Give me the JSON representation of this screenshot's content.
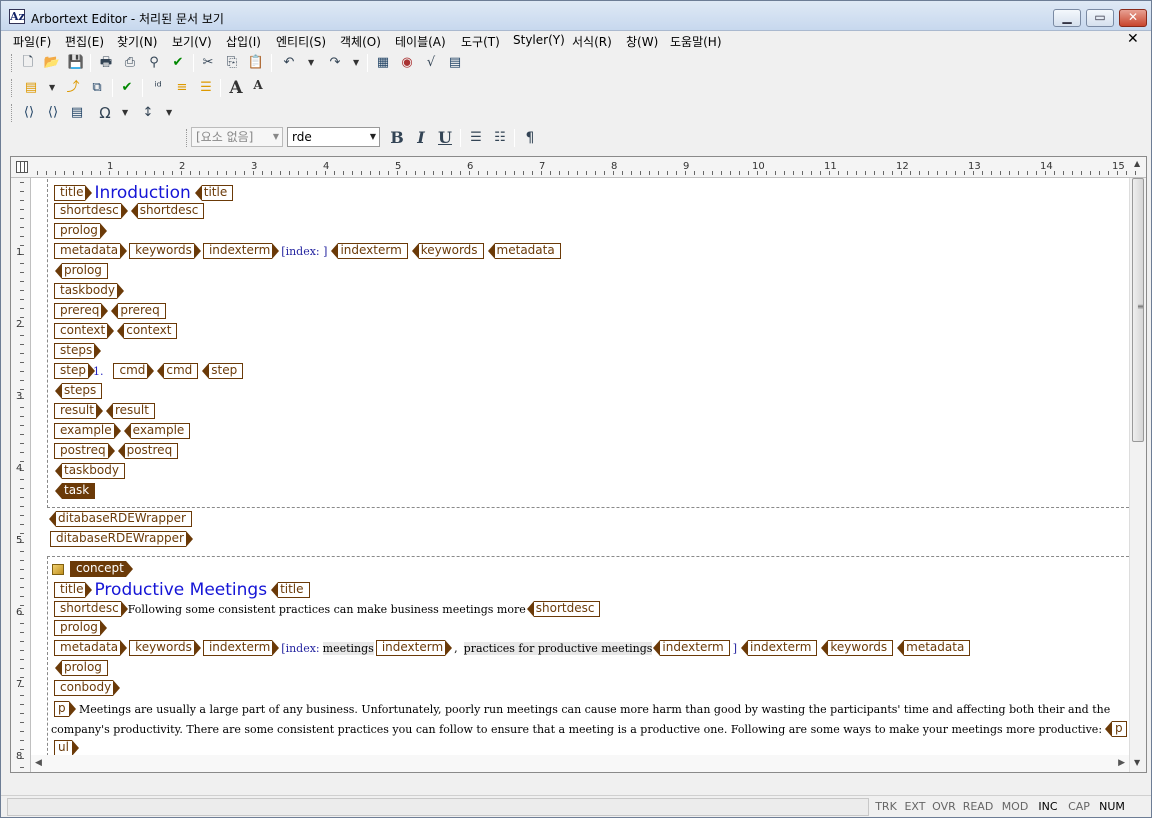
{
  "window": {
    "app_name": "Arbortext Editor",
    "title_sep": " - ",
    "doc_title": "처리된 문서 보기",
    "app_icon": "Az"
  },
  "menu": [
    "파일(F)",
    "편집(E)",
    "찾기(N)",
    "보기(V)",
    "삽입(I)",
    "엔티티(S)",
    "객체(O)",
    "테이블(A)",
    "도구(T)",
    "Styler(Y)",
    "서식(R)",
    "창(W)",
    "도움말(H)"
  ],
  "toolbar": {
    "element_combo": "[요소 없음]",
    "style_combo": "rde",
    "bold": "B",
    "italic": "I",
    "underline": "U",
    "pilcrow": "¶"
  },
  "ruler": {
    "h": [
      "1",
      "2",
      "3",
      "4",
      "5",
      "6",
      "7",
      "8",
      "9",
      "10",
      "11",
      "12",
      "13",
      "14",
      "15"
    ],
    "v": [
      "1",
      "2",
      "3",
      "4",
      "5",
      "6",
      "7",
      "8"
    ]
  },
  "doc": {
    "task": {
      "title": "Inroduction",
      "index_label": "[index: ]",
      "step_num": "1.",
      "tags": {
        "title": "title",
        "shortdesc": "shortdesc",
        "prolog": "prolog",
        "metadata": "metadata",
        "keywords": "keywords",
        "indexterm": "indexterm",
        "taskbody": "taskbody",
        "prereq": "prereq",
        "context": "context",
        "steps": "steps",
        "step": "step",
        "cmd": "cmd",
        "result": "result",
        "example": "example",
        "postreq": "postreq",
        "task": "task"
      }
    },
    "wrapper": "ditabaseRDEWrapper",
    "concept": {
      "tag": "concept",
      "title": "Productive Meetings",
      "shortdesc": "Following some consistent practices can make business meetings more",
      "index_label": "[index:",
      "index_term1": "meetings",
      "index_comma": ",",
      "index_term2": "practices for productive meetings",
      "index_close": "]",
      "conbody": "conbody",
      "p_tag": "p",
      "ul_tag": "ul",
      "p_line1": "Meetings are usually a large part of any business. Unfortunately, poorly run meetings can cause more harm than good by wasting the participants' time and affecting both their and the",
      "p_line2": "company's productivity. There are some consistent practices you can follow to ensure that a meeting is a productive one. Following are some ways to make your meetings more productive:"
    }
  },
  "status": {
    "indicators": [
      "TRK",
      "EXT",
      "OVR",
      "READ",
      "MOD",
      "INC",
      "CAP",
      "NUM"
    ],
    "active": [
      "INC",
      "NUM"
    ]
  }
}
